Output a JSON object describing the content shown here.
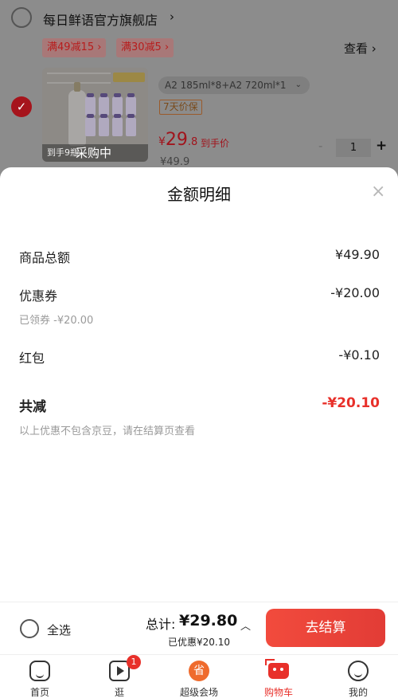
{
  "store": {
    "name": "每日鲜语官方旗舰店",
    "arrow": "›",
    "promos": [
      "满49减15 ›",
      "满30减5 ›"
    ],
    "view_label": "查看 ›"
  },
  "item": {
    "thumb_small_text": "到手9瓶",
    "thumb_status": "采购中",
    "spec": "A2 185ml*8+A2 720ml*1",
    "warranty": "7天价保",
    "price_symbol": "¥",
    "price_int": "29",
    "price_dec": ".8",
    "price_note": "到手价",
    "orig_price": "¥49.9",
    "qty": "1",
    "minus": "-",
    "plus": "+"
  },
  "sheet": {
    "title": "金额明细",
    "close": "×",
    "rows": [
      {
        "label": "商品总额",
        "value": "¥49.90"
      },
      {
        "label": "优惠券",
        "value": "-¥20.00",
        "note": "已领券 -¥20.00"
      },
      {
        "label": "红包",
        "value": "-¥0.10"
      }
    ],
    "total_label": "共减",
    "total_value": "-¥20.10",
    "footnote": "以上优惠不包含京豆，请在结算页查看"
  },
  "checkout": {
    "select_all": "全选",
    "total_label": "总计:",
    "total_value": "¥29.80",
    "saved": "已优惠¥20.10",
    "expand": "︿",
    "pay_button": "去结算"
  },
  "tabs": [
    {
      "label": "首页",
      "icon": "home-icon"
    },
    {
      "label": "逛",
      "icon": "browse-icon",
      "badge": "1"
    },
    {
      "label": "超级会场",
      "icon": "super-venue-icon",
      "glyph": "省"
    },
    {
      "label": "购物车",
      "icon": "cart-icon",
      "active": true
    },
    {
      "label": "我的",
      "icon": "profile-icon"
    }
  ],
  "colors": {
    "accent": "#e8302a",
    "overlay": "#8c8c8c"
  }
}
